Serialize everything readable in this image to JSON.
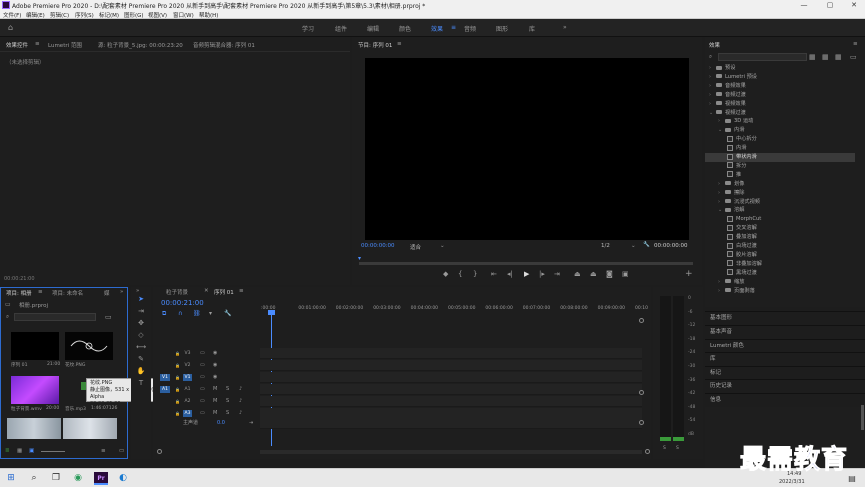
{
  "window": {
    "title": "Adobe Premiere Pro 2020 - D:\\配套素材 Premiere Pro 2020 从新手到高手\\配套素材 Premiere Pro 2020 从新手到高手\\第5章\\5.3\\素材\\相册.prproj *",
    "min": "—",
    "max": "▢",
    "close": "✕"
  },
  "menu": [
    "文件(F)",
    "编辑(E)",
    "剪辑(C)",
    "序列(S)",
    "标记(M)",
    "图形(G)",
    "视图(V)",
    "窗口(W)",
    "帮助(H)"
  ],
  "workspaces": [
    {
      "label": "学习"
    },
    {
      "label": "组件"
    },
    {
      "label": "编辑"
    },
    {
      "label": "颜色"
    },
    {
      "label": "效果",
      "active": true
    },
    {
      "label": "音频"
    },
    {
      "label": "图形"
    },
    {
      "label": "库"
    }
  ],
  "workspace_more": "»",
  "source_panel": {
    "tabs": [
      "效果控件",
      "Lumetri 范围",
      "源: 粒子背景_5.jpg: 00:00:23:20",
      "音频剪辑混合器: 序列 01"
    ],
    "empty": "（未选择剪辑）",
    "timecode": "00:00:21:00"
  },
  "program_panel": {
    "tab": "节目: 序列 01",
    "timecode": "00:00:00:00",
    "fit": "适合",
    "res": "1/2",
    "duration": "00:00:00:00"
  },
  "effects_panel": {
    "tab": "效果",
    "tree": [
      {
        "label": "预设",
        "type": "folder",
        "indent": 0,
        "arrow": "›"
      },
      {
        "label": "Lumetri 预设",
        "type": "folder",
        "indent": 0,
        "arrow": "›"
      },
      {
        "label": "音频效果",
        "type": "folder",
        "indent": 0,
        "arrow": "›"
      },
      {
        "label": "音频过渡",
        "type": "folder",
        "indent": 0,
        "arrow": "›"
      },
      {
        "label": "视频效果",
        "type": "folder",
        "indent": 0,
        "arrow": "›"
      },
      {
        "label": "视频过渡",
        "type": "folder",
        "indent": 0,
        "arrow": "⌄"
      },
      {
        "label": "3D 运动",
        "type": "folder",
        "indent": 1,
        "arrow": "›"
      },
      {
        "label": "内滑",
        "type": "folder",
        "indent": 1,
        "arrow": "⌄"
      },
      {
        "label": "中心拆分",
        "type": "fx",
        "indent": 2
      },
      {
        "label": "内滑",
        "type": "fx",
        "indent": 2
      },
      {
        "label": "带状内滑",
        "type": "fx",
        "indent": 2,
        "selected": true
      },
      {
        "label": "拆分",
        "type": "fx",
        "indent": 2
      },
      {
        "label": "推",
        "type": "fx",
        "indent": 2
      },
      {
        "label": "划像",
        "type": "folder",
        "indent": 1,
        "arrow": "›"
      },
      {
        "label": "擦除",
        "type": "folder",
        "indent": 1,
        "arrow": "›"
      },
      {
        "label": "沉浸式视频",
        "type": "folder",
        "indent": 1,
        "arrow": "›"
      },
      {
        "label": "溶解",
        "type": "folder",
        "indent": 1,
        "arrow": "⌄"
      },
      {
        "label": "MorphCut",
        "type": "fx",
        "indent": 2
      },
      {
        "label": "交叉溶解",
        "type": "fx",
        "indent": 2
      },
      {
        "label": "叠加溶解",
        "type": "fx",
        "indent": 2
      },
      {
        "label": "白场过渡",
        "type": "fx",
        "indent": 2
      },
      {
        "label": "胶片溶解",
        "type": "fx",
        "indent": 2
      },
      {
        "label": "非叠加溶解",
        "type": "fx",
        "indent": 2
      },
      {
        "label": "黑场过渡",
        "type": "fx",
        "indent": 2
      },
      {
        "label": "缩放",
        "type": "folder",
        "indent": 1,
        "arrow": "›"
      },
      {
        "label": "页面剥落",
        "type": "folder",
        "indent": 1,
        "arrow": "›"
      }
    ]
  },
  "side_panels": [
    "基本图形",
    "基本声音",
    "Lumetri 颜色",
    "库",
    "标记",
    "历史记录",
    "信息"
  ],
  "project_panel": {
    "tabs": [
      "项目: 相册",
      "项目: 未命名",
      "媒"
    ],
    "file": "相册.prproj",
    "items": [
      {
        "name": "序列 01",
        "meta": "21:00"
      },
      {
        "name": "花纹.PNG",
        "meta": ""
      },
      {
        "name": "粒子背景.wmv",
        "meta": "20:00"
      },
      {
        "name": "音乐.mp3",
        "meta": "1:46:07126"
      }
    ],
    "tooltip": {
      "name": "花纹.PNG",
      "line1": "静止图像，531 x 278 (1.0)，直接 Alpha",
      "line2": "00:00:05:00"
    }
  },
  "timeline": {
    "tabs": [
      "粒子背景",
      "序列 01"
    ],
    "timecode": "00:00:21:00",
    "ticks": [
      ":00:00",
      "00:01:00:00",
      "00:02:00:00",
      "00:03:00:00",
      "00:04:00:00",
      "00:05:00:00",
      "00:06:00:00",
      "00:07:00:00",
      "00:08:00:00",
      "00:09:00:00",
      "00:10"
    ],
    "tracks": [
      {
        "name": "V3",
        "kind": "video"
      },
      {
        "name": "V2",
        "kind": "video"
      },
      {
        "name": "V1",
        "kind": "video",
        "src": "V1"
      },
      {
        "name": "A1",
        "kind": "audio",
        "src": "A1"
      },
      {
        "name": "A2",
        "kind": "audio"
      },
      {
        "name": "A3",
        "kind": "audio"
      }
    ],
    "master": "主声道",
    "master_val": "0.0"
  },
  "meter": {
    "scale": [
      "0",
      "-6",
      "-12",
      "-18",
      "-24",
      "-30",
      "-36",
      "-42",
      "-48",
      "-54",
      "dB"
    ],
    "solo": "S"
  },
  "taskbar": {
    "time": "14:49",
    "date": "2022/3/31"
  },
  "watermark": "最需教育"
}
